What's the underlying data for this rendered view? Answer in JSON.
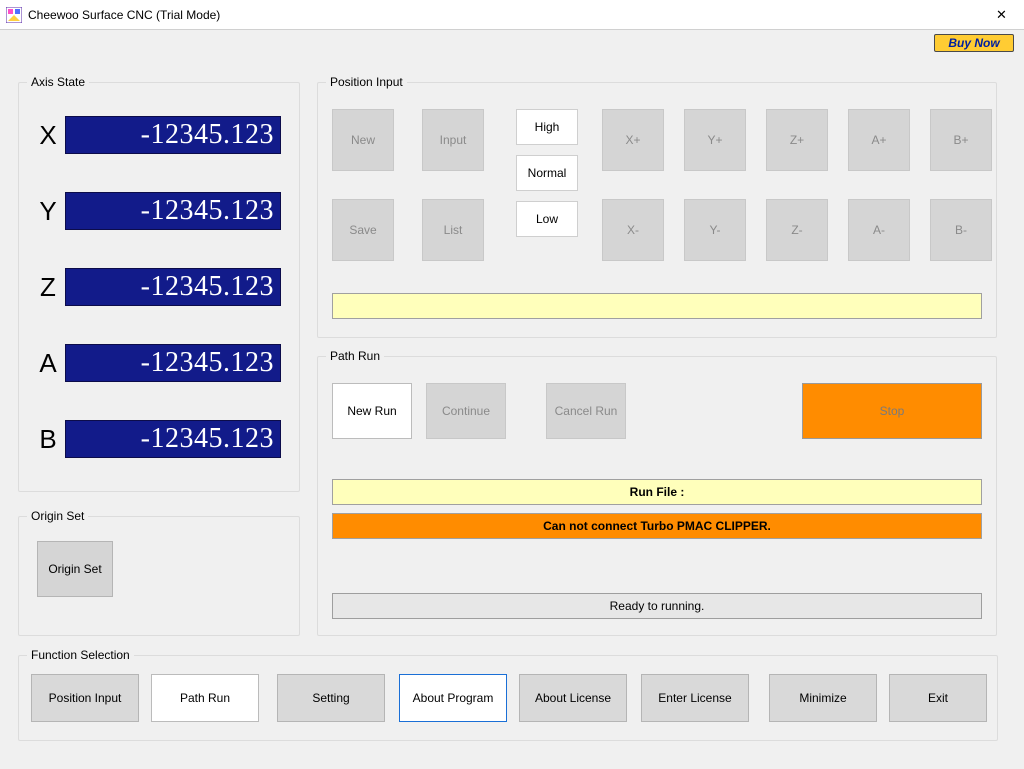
{
  "window": {
    "title": "Cheewoo Surface CNC (Trial Mode)",
    "close": "✕"
  },
  "buy_now": "Buy Now",
  "axis_state": {
    "title": "Axis State",
    "axes": [
      {
        "label": "X",
        "value": "-12345.123"
      },
      {
        "label": "Y",
        "value": "-12345.123"
      },
      {
        "label": "Z",
        "value": "-12345.123"
      },
      {
        "label": "A",
        "value": "-12345.123"
      },
      {
        "label": "B",
        "value": "-12345.123"
      }
    ]
  },
  "origin_set": {
    "title": "Origin Set",
    "button": "Origin Set"
  },
  "position_input": {
    "title": "Position Input",
    "buttons": {
      "new": "New",
      "input": "Input",
      "save": "Save",
      "list": "List",
      "high": "High",
      "normal": "Normal",
      "low": "Low",
      "xp": "X+",
      "yp": "Y+",
      "zp": "Z+",
      "ap": "A+",
      "bp": "B+",
      "xm": "X-",
      "ym": "Y-",
      "zm": "Z-",
      "am": "A-",
      "bm": "B-"
    },
    "message": ""
  },
  "path_run": {
    "title": "Path Run",
    "new_run": "New Run",
    "continue": "Continue",
    "cancel_run": "Cancel Run",
    "stop": "Stop",
    "run_file_label": "Run File :",
    "error": "Can not connect Turbo PMAC CLIPPER.",
    "ready": "Ready to running."
  },
  "function_selection": {
    "title": "Function Selection",
    "items": [
      "Position Input",
      "Path Run",
      "Setting",
      "About Program",
      "About License",
      "Enter License",
      "Minimize",
      "Exit"
    ]
  }
}
